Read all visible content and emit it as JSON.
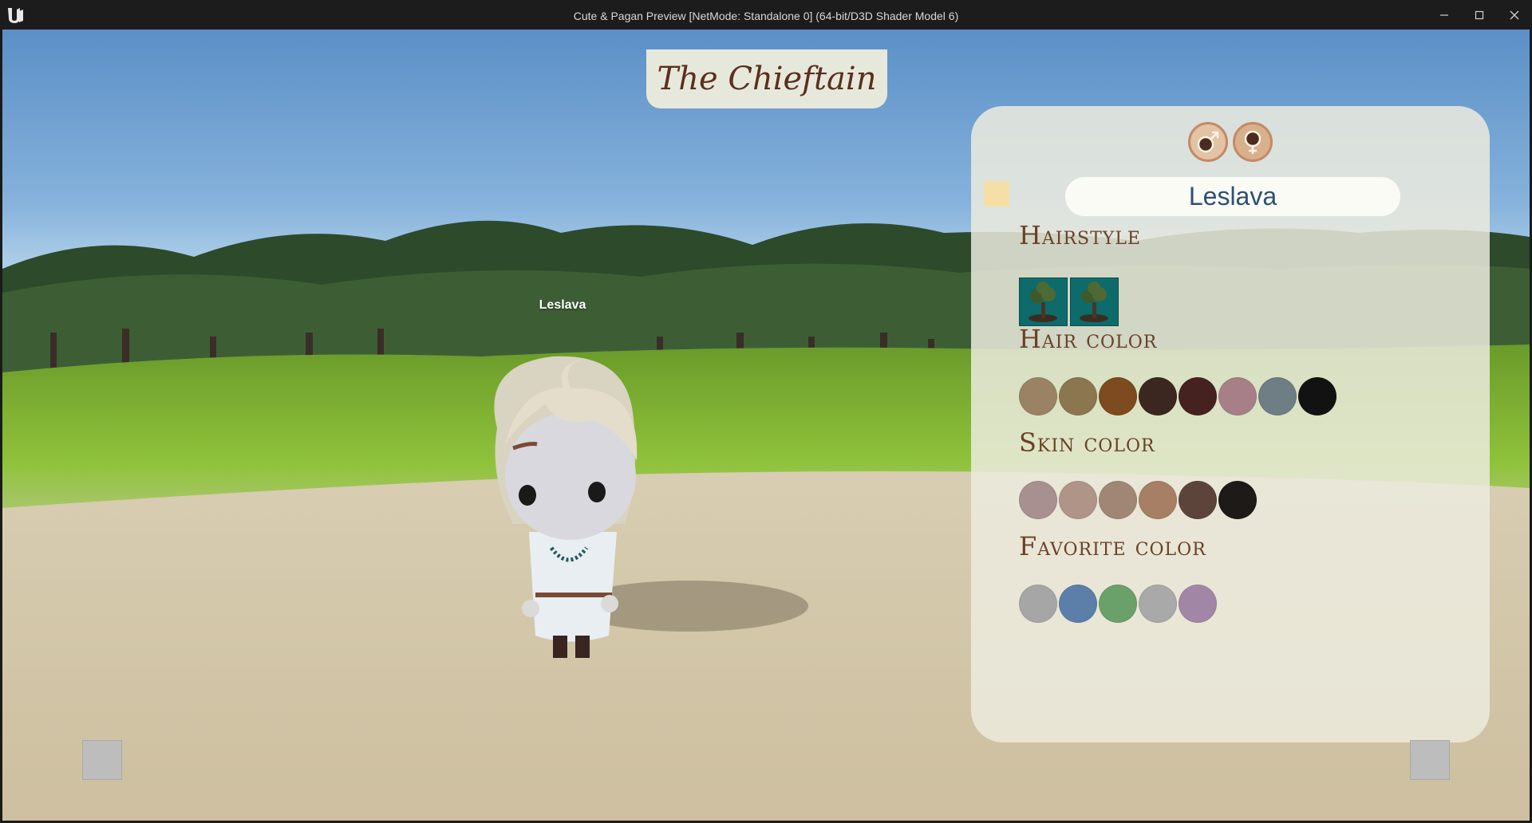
{
  "window": {
    "title": "Cute & Pagan Preview [NetMode: Standalone 0]  (64-bit/D3D Shader Model 6)"
  },
  "header": {
    "title": "The Chieftain"
  },
  "character": {
    "name_tag": "Leslava"
  },
  "panel": {
    "gender_buttons": [
      {
        "icon": "male-icon"
      },
      {
        "icon": "female-icon",
        "selected": true
      }
    ],
    "name_value": "Leslava",
    "sections": {
      "hairstyle": "Hairstyle",
      "hair_color": "Hair color",
      "skin_color": "Skin color",
      "favorite_color": "Favorite color"
    },
    "hairstyles": [
      "hairstyle-1",
      "hairstyle-2"
    ],
    "hair_colors": [
      "#9c8264",
      "#8c7650",
      "#7e4a1f",
      "#3c2720",
      "#452220",
      "#a77f88",
      "#6f7d85",
      "#121212"
    ],
    "skin_colors": [
      "#a99090",
      "#b09488",
      "#a28675",
      "#a67f64",
      "#5c443b",
      "#1e1a18"
    ],
    "favorite_colors": [
      "#a6a6a6",
      "#5b7fa8",
      "#6aa06a",
      "#a9a9a9",
      "#a186a5"
    ]
  }
}
